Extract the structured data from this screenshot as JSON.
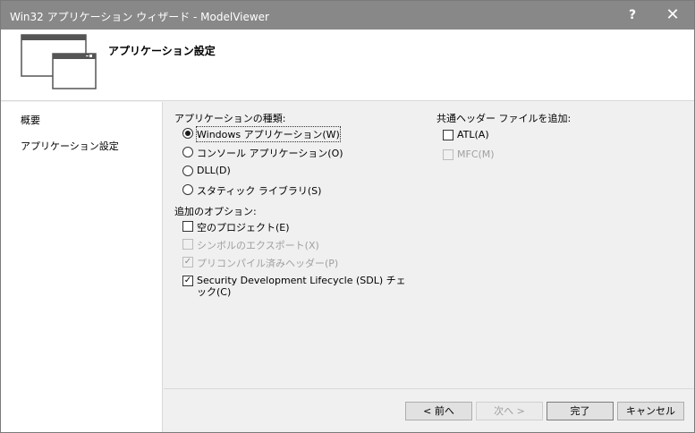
{
  "window": {
    "title": "Win32 アプリケーション ウィザード - ModelViewer",
    "help_glyph": "?",
    "close_glyph": "✕"
  },
  "header": {
    "title": "アプリケーション設定",
    "icon": "wizard-windows-icon"
  },
  "sidebar": {
    "items": [
      {
        "label": "概要"
      },
      {
        "label": "アプリケーション設定",
        "selected": true
      }
    ]
  },
  "app_type": {
    "label": "アプリケーションの種類:",
    "options": [
      {
        "label": "Windows アプリケーション(W)",
        "selected": true
      },
      {
        "label": "コンソール アプリケーション(O)",
        "selected": false
      },
      {
        "label": "DLL(D)",
        "selected": false
      },
      {
        "label": "スタティック ライブラリ(S)",
        "selected": false
      }
    ]
  },
  "additional_options": {
    "label": "追加のオプション:",
    "options": [
      {
        "label": "空のプロジェクト(E)",
        "checked": false,
        "enabled": true
      },
      {
        "label": "シンボルのエクスポート(X)",
        "checked": false,
        "enabled": false
      },
      {
        "label": "プリコンパイル済みヘッダー(P)",
        "checked": true,
        "enabled": false
      },
      {
        "label": "Security Development Lifecycle (SDL) チェック(C)",
        "checked": true,
        "enabled": true
      }
    ]
  },
  "common_headers": {
    "label": "共通ヘッダー ファイルを追加:",
    "options": [
      {
        "label": "ATL(A)",
        "checked": false,
        "enabled": true
      },
      {
        "label": "MFC(M)",
        "checked": false,
        "enabled": false
      }
    ]
  },
  "buttons": {
    "back": "< 前へ",
    "next": "次へ >",
    "finish": "完了",
    "cancel": "キャンセル"
  }
}
